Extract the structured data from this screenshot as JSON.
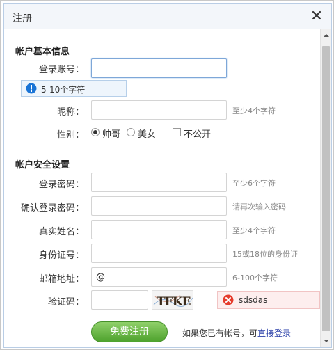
{
  "dialog": {
    "title": "注册",
    "close_icon": "close-icon"
  },
  "basic": {
    "section_title": "帐户基本信息",
    "account_label": "登录账号：",
    "account_value": "",
    "account_tip": "5-10个字符",
    "nickname_label": "昵称：",
    "nickname_hint": "至少4个字符",
    "gender_label": "性别：",
    "gender_options": [
      "帅哥",
      "美女"
    ],
    "gender_selected": "帅哥",
    "hide_label": "不公开"
  },
  "security": {
    "section_title": "帐户安全设置",
    "password_label": "登录密码：",
    "password_hint": "至少6个字符",
    "confirm_label": "确认登录密码：",
    "confirm_hint": "请再次输入密码",
    "realname_label": "真实姓名：",
    "realname_hint": "至少4个字符",
    "idcard_label": "身份证号：",
    "idcard_hint": "15或18位的身份证",
    "email_label": "邮箱地址：",
    "email_value": "@",
    "email_hint": "6-100个字符",
    "captcha_label": "验证码：",
    "captcha_image_text": "TFKE",
    "captcha_error": "sdsdas"
  },
  "footer": {
    "submit_label": "免费注册",
    "login_prefix": "如果您已有帐号，可",
    "login_link": "直接登录"
  },
  "colors": {
    "accent_blue": "#7ea7d8",
    "submit_green": "#4ea22d",
    "link": "#2a3fa8",
    "error_red": "#e53b2c",
    "info_blue": "#1a74d6"
  }
}
